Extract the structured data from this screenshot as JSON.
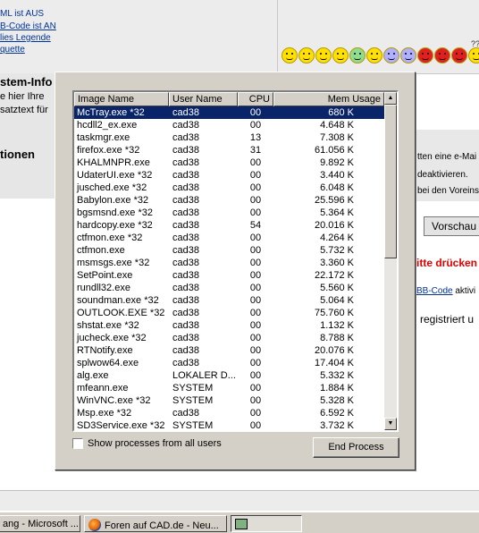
{
  "background_page": {
    "top_left_lines": [
      "ML ist AUS",
      "B-Code ist AN",
      "lies Legende",
      "quette"
    ],
    "left_section_title": "stem-Info",
    "left_texts": [
      "e hier Ihre",
      "satztext für"
    ],
    "left_section_title_2": "tionen",
    "right_texts": [
      "tten eine e-Mai",
      "deaktivieren.",
      "bei den Voreins"
    ],
    "preview_button": "Vorschau",
    "red_text": "itte drücken",
    "bbcode_link": "BB-Code",
    "bbcode_suffix": " aktivi",
    "registered_text": "registriert u",
    "smiley_count": 12,
    "question_marks": "??"
  },
  "task_manager": {
    "columns": [
      "Image Name",
      "User Name",
      "CPU",
      "Mem Usage"
    ],
    "selected_row": 0,
    "processes": [
      {
        "name": "McTray.exe *32",
        "user": "cad38",
        "cpu": "00",
        "mem": "680 K"
      },
      {
        "name": "hcdll2_ex.exe",
        "user": "cad38",
        "cpu": "00",
        "mem": "4.648 K"
      },
      {
        "name": "taskmgr.exe",
        "user": "cad38",
        "cpu": "13",
        "mem": "7.308 K"
      },
      {
        "name": "firefox.exe *32",
        "user": "cad38",
        "cpu": "31",
        "mem": "61.056 K"
      },
      {
        "name": "KHALMNPR.exe",
        "user": "cad38",
        "cpu": "00",
        "mem": "9.892 K"
      },
      {
        "name": "UdaterUI.exe *32",
        "user": "cad38",
        "cpu": "00",
        "mem": "3.440 K"
      },
      {
        "name": "jusched.exe *32",
        "user": "cad38",
        "cpu": "00",
        "mem": "6.048 K"
      },
      {
        "name": "Babylon.exe *32",
        "user": "cad38",
        "cpu": "00",
        "mem": "25.596 K"
      },
      {
        "name": "bgsmsnd.exe *32",
        "user": "cad38",
        "cpu": "00",
        "mem": "5.364 K"
      },
      {
        "name": "hardcopy.exe *32",
        "user": "cad38",
        "cpu": "54",
        "mem": "20.016 K"
      },
      {
        "name": "ctfmon.exe *32",
        "user": "cad38",
        "cpu": "00",
        "mem": "4.264 K"
      },
      {
        "name": "ctfmon.exe",
        "user": "cad38",
        "cpu": "00",
        "mem": "5.732 K"
      },
      {
        "name": "msmsgs.exe *32",
        "user": "cad38",
        "cpu": "00",
        "mem": "3.360 K"
      },
      {
        "name": "SetPoint.exe",
        "user": "cad38",
        "cpu": "00",
        "mem": "22.172 K"
      },
      {
        "name": "rundll32.exe",
        "user": "cad38",
        "cpu": "00",
        "mem": "5.560 K"
      },
      {
        "name": "soundman.exe *32",
        "user": "cad38",
        "cpu": "00",
        "mem": "5.064 K"
      },
      {
        "name": "OUTLOOK.EXE *32",
        "user": "cad38",
        "cpu": "00",
        "mem": "75.760 K"
      },
      {
        "name": "shstat.exe *32",
        "user": "cad38",
        "cpu": "00",
        "mem": "1.132 K"
      },
      {
        "name": "jucheck.exe *32",
        "user": "cad38",
        "cpu": "00",
        "mem": "8.788 K"
      },
      {
        "name": "RTNotify.exe",
        "user": "cad38",
        "cpu": "00",
        "mem": "20.076 K"
      },
      {
        "name": "splwow64.exe",
        "user": "cad38",
        "cpu": "00",
        "mem": "17.404 K"
      },
      {
        "name": "alg.exe",
        "user": "LOKALER D...",
        "cpu": "00",
        "mem": "5.332 K"
      },
      {
        "name": "mfeann.exe",
        "user": "SYSTEM",
        "cpu": "00",
        "mem": "1.884 K"
      },
      {
        "name": "WinVNC.exe *32",
        "user": "SYSTEM",
        "cpu": "00",
        "mem": "5.328 K"
      },
      {
        "name": "Msp.exe *32",
        "user": "cad38",
        "cpu": "00",
        "mem": "6.592 K"
      },
      {
        "name": "SD3Service.exe *32",
        "user": "SYSTEM",
        "cpu": "00",
        "mem": "3.732 K"
      }
    ],
    "show_all_label": "Show processes from all users",
    "show_all_checked": false,
    "end_process_label": "End Process"
  },
  "taskbar": {
    "items": [
      "ang - Microsoft ...",
      "Foren auf CAD.de - Neu...",
      ""
    ]
  },
  "colors": {
    "selection": "#0a246a",
    "dialog_face": "#d4d0c8",
    "link": "#003399",
    "alert_red": "#e00000"
  }
}
